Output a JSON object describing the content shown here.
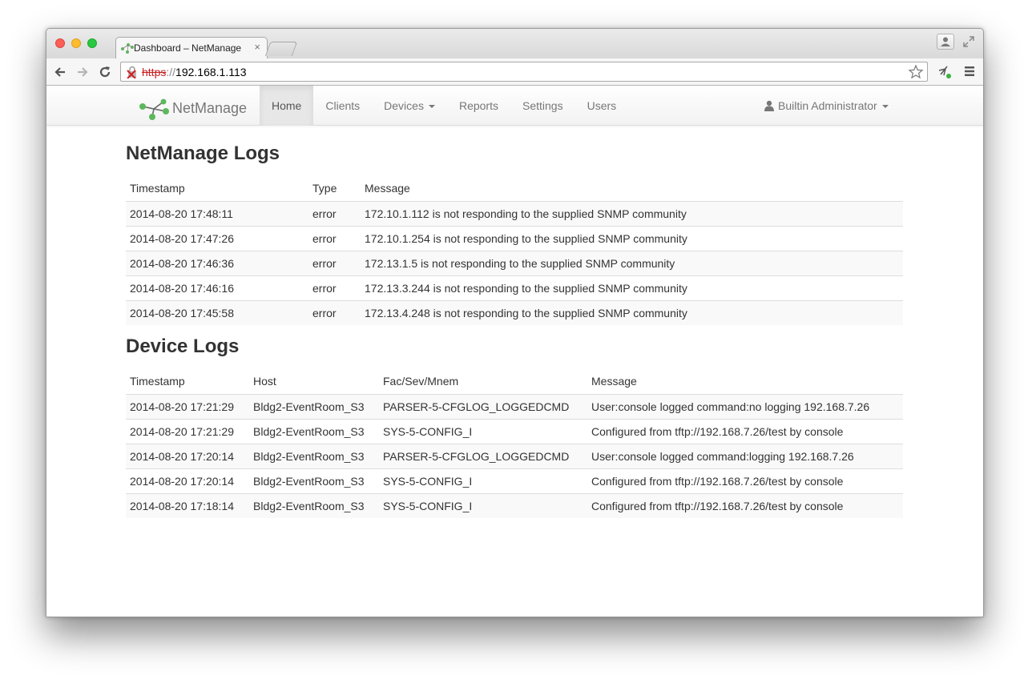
{
  "browser": {
    "tab_title": "Dashboard – NetManage",
    "tab_close": "×",
    "url_scheme": "https",
    "url_sep": "://",
    "url_host": "192.168.1.113"
  },
  "navbar": {
    "brand": "NetManage",
    "items": [
      {
        "label": "Home",
        "active": true
      },
      {
        "label": "Clients"
      },
      {
        "label": "Devices",
        "dropdown": true
      },
      {
        "label": "Reports"
      },
      {
        "label": "Settings"
      },
      {
        "label": "Users"
      }
    ],
    "user": "Builtin Administrator"
  },
  "netmanage_logs": {
    "title": "NetManage Logs",
    "columns": [
      "Timestamp",
      "Type",
      "Message"
    ],
    "rows": [
      [
        "2014-08-20 17:48:11",
        "error",
        "172.10.1.112 is not responding to the supplied SNMP community"
      ],
      [
        "2014-08-20 17:47:26",
        "error",
        "172.10.1.254 is not responding to the supplied SNMP community"
      ],
      [
        "2014-08-20 17:46:36",
        "error",
        "172.13.1.5 is not responding to the supplied SNMP community"
      ],
      [
        "2014-08-20 17:46:16",
        "error",
        "172.13.3.244 is not responding to the supplied SNMP community"
      ],
      [
        "2014-08-20 17:45:58",
        "error",
        "172.13.4.248 is not responding to the supplied SNMP community"
      ]
    ]
  },
  "device_logs": {
    "title": "Device Logs",
    "columns": [
      "Timestamp",
      "Host",
      "Fac/Sev/Mnem",
      "Message"
    ],
    "rows": [
      [
        "2014-08-20 17:21:29",
        "Bldg2-EventRoom_S3",
        "PARSER-5-CFGLOG_LOGGEDCMD",
        "User:console logged command:no logging 192.168.7.26"
      ],
      [
        "2014-08-20 17:21:29",
        "Bldg2-EventRoom_S3",
        "SYS-5-CONFIG_I",
        "Configured from tftp://192.168.7.26/test by console"
      ],
      [
        "2014-08-20 17:20:14",
        "Bldg2-EventRoom_S3",
        "PARSER-5-CFGLOG_LOGGEDCMD",
        "User:console logged command:logging 192.168.7.26"
      ],
      [
        "2014-08-20 17:20:14",
        "Bldg2-EventRoom_S3",
        "SYS-5-CONFIG_I",
        "Configured from tftp://192.168.7.26/test by console"
      ],
      [
        "2014-08-20 17:18:14",
        "Bldg2-EventRoom_S3",
        "SYS-5-CONFIG_I",
        "Configured from tftp://192.168.7.26/test by console"
      ]
    ]
  },
  "colors": {
    "brand_green": "#5cb85c",
    "text": "#333333",
    "nav_text": "#777777",
    "error_scheme": "#c72020"
  },
  "icons": [
    "favicon-icon",
    "back-icon",
    "forward-icon",
    "reload-icon",
    "insecure-lock-icon",
    "star-icon",
    "extension-icon",
    "menu-icon",
    "profile-icon",
    "fullscreen-icon",
    "brand-logo-icon",
    "user-icon"
  ]
}
